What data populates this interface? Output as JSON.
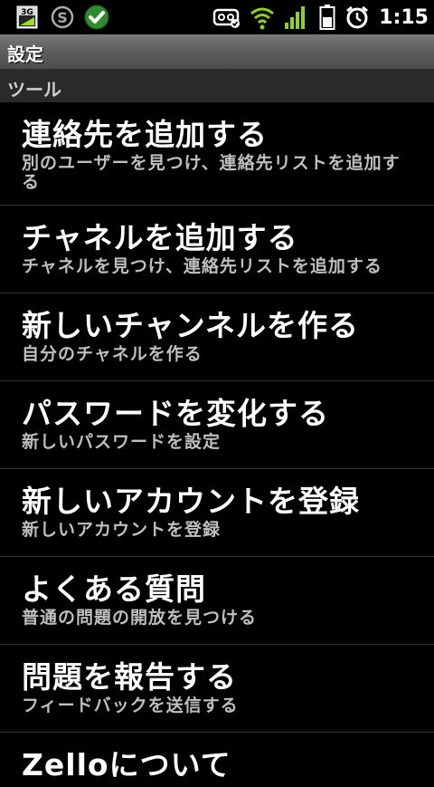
{
  "status_bar": {
    "network_badge": "3G",
    "time": "1:15",
    "icons": [
      "network-3g-icon",
      "skype-icon",
      "check-icon",
      "voicemail-icon",
      "wifi-icon",
      "signal-icon",
      "battery-icon",
      "alarm-icon"
    ],
    "colors": {
      "check": "#2e8b2e",
      "wifi": "#8ed31c",
      "signal": "#8ed31c"
    }
  },
  "title_bar": {
    "title": "設定"
  },
  "section": {
    "label": "ツール"
  },
  "menu": {
    "items": [
      {
        "title": "連絡先を追加する",
        "subtitle": "別のユーザーを見つけ、連絡先リストを追加する"
      },
      {
        "title": "チャネルを追加する",
        "subtitle": "チャネルを見つけ、連絡先リストを追加する"
      },
      {
        "title": "新しいチャンネルを作る",
        "subtitle": "自分のチャネルを作る"
      },
      {
        "title": "パスワードを変化する",
        "subtitle": "新しいパスワードを設定"
      },
      {
        "title": "新しいアカウントを登録",
        "subtitle": "新しいアカウントを登録"
      },
      {
        "title": "よくある質問",
        "subtitle": "普通の問題の開放を見つける"
      },
      {
        "title": "問題を報告する",
        "subtitle": "フィードバックを送信する"
      },
      {
        "title": "Zelloについて",
        "subtitle": ""
      }
    ]
  }
}
